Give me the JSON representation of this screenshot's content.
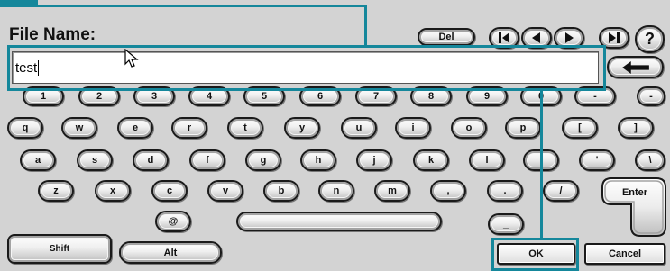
{
  "window": {
    "label": "File Name:"
  },
  "toolbar": {
    "del_label": "Del",
    "nav_buttons": [
      {
        "icon": "skip-first-icon"
      },
      {
        "icon": "previous-icon"
      },
      {
        "icon": "next-icon"
      },
      {
        "icon": "skip-last-icon"
      }
    ],
    "help_label": "?"
  },
  "input": {
    "value": "test"
  },
  "backspace": {
    "icon": "backspace-arrow-icon"
  },
  "pointer": {
    "icon": "mouse-pointer-icon"
  },
  "keyboard": {
    "rows": [
      [
        "1",
        "2",
        "3",
        "4",
        "5",
        "6",
        "7",
        "8",
        "9",
        "0",
        "-",
        "-"
      ],
      [
        "q",
        "w",
        "e",
        "r",
        "t",
        "y",
        "u",
        "i",
        "o",
        "p",
        "[",
        "]"
      ],
      [
        "a",
        "s",
        "d",
        "f",
        "g",
        "h",
        "j",
        "k",
        "l",
        ";",
        "'",
        "\\"
      ],
      [
        "z",
        "x",
        "c",
        "v",
        "b",
        "n",
        "m",
        ",",
        ".",
        "/"
      ]
    ],
    "enter_label": "Enter",
    "at_label": "@",
    "underscore_label": "_",
    "shift_label": "Shift",
    "alt_label": "Alt"
  },
  "actions": {
    "ok_label": "OK",
    "cancel_label": "Cancel"
  },
  "colors": {
    "highlight": "#15879b",
    "background": "#d3d3d3"
  }
}
